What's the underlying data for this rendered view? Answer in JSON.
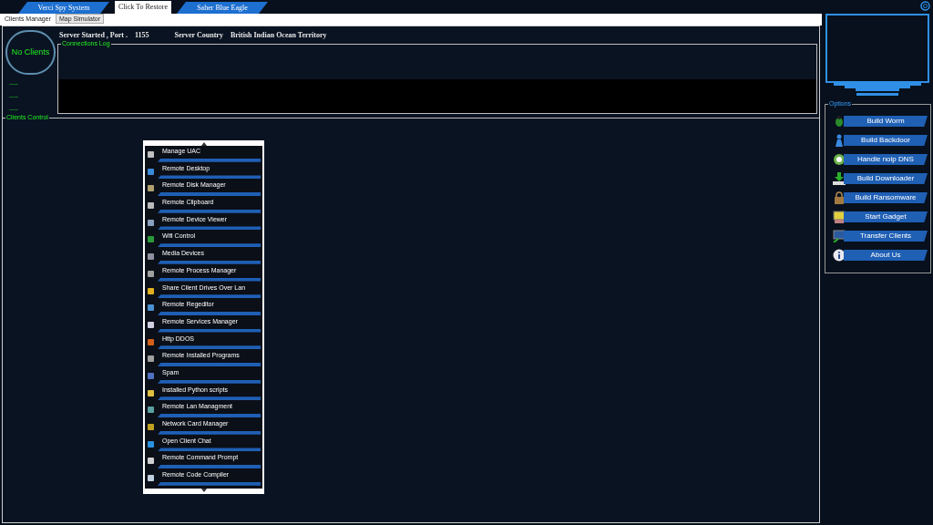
{
  "top_tabs": [
    {
      "label": "Verci Spy System",
      "selected": false
    },
    {
      "label": "Click To Restore",
      "selected": true
    },
    {
      "label": "Saher Blue Eagle",
      "selected": false
    }
  ],
  "sub_tabs": [
    {
      "label": "Clients Manager",
      "selected": true
    },
    {
      "label": "Map Simulator",
      "selected": false
    }
  ],
  "clients_badge": "No Clients",
  "status_lines": [
    "------",
    "------",
    "------"
  ],
  "server_info": [
    {
      "label": "Server Started , Port .",
      "value": "1155"
    },
    {
      "label": "Server  Country",
      "value": "British Indian Ocean Territory"
    }
  ],
  "connections_log": {
    "title": "Connections Log"
  },
  "clients_control": {
    "title": "Clients Control"
  },
  "context_menu": [
    "Manage UAC",
    "Remote Desktop",
    "Remote Disk Manager",
    "Remote Clipboard",
    "Remote Device Viewer",
    "Wifi Control",
    "Media Devices",
    "Remote Process Manager",
    "Share Client Drives Over Lan",
    "Remote Regeditor",
    "Remote Services Manager",
    "Http DDOS",
    "Remote Installed Programs",
    "Spam",
    "Installed Python scripts",
    "Remote Lan Managment",
    "Network Card Manager",
    "Open Client Chat",
    "Remote Command Prompt",
    "Remote Code Compiler"
  ],
  "options": {
    "title": "Options",
    "buttons": [
      "Build Worm",
      "Build Backdoor",
      "Handle noip DNS",
      "Build Downloader",
      "Build Ransomware",
      "Start Gadget",
      "Transfer Clients",
      "About Us"
    ]
  }
}
